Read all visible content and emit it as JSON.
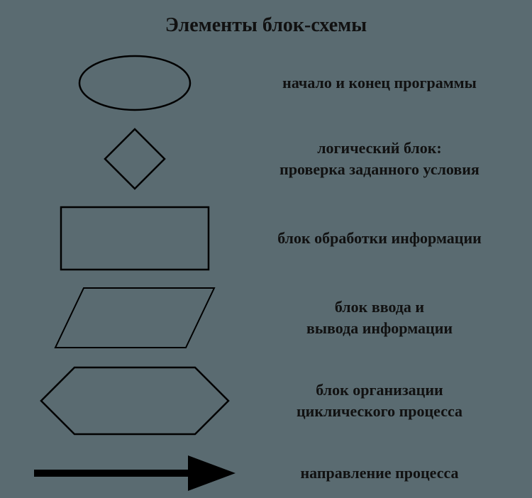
{
  "title": "Элементы блок-схемы",
  "items": [
    {
      "label": "начало и конец программы"
    },
    {
      "label": "логический блок:\nпроверка заданного условия"
    },
    {
      "label": "блок обработки информации"
    },
    {
      "label": "блок ввода и\nвывода информации"
    },
    {
      "label": "блок организации\nциклического процесса"
    },
    {
      "label": "направление процесса"
    }
  ]
}
